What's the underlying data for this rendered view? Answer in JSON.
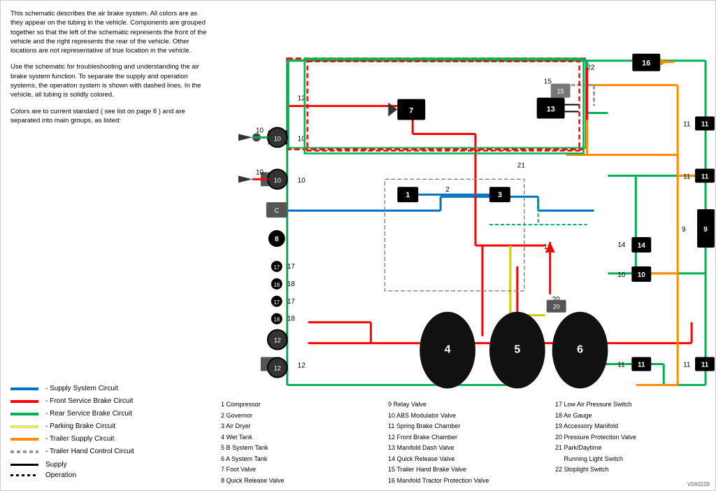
{
  "description1": "This schematic describes the air brake system. All colors are as they appear on the tubing in the vehicle. Components are grouped together so that the left of the schematic represents the front of the vehicle and the right represents the rear of the vehicle. Other locations are not representative of true location in the vehicle.",
  "description2": "Use the schematic for troubleshooting and understanding the air brake system function. To separate the supply and operation systems, the operation system is shown with dashed lines. In the vehicle, all tubing is solidly colored.",
  "description3": "Colors are to current standard ( see list on page 8 ) and are separated into main groups, as listed:",
  "legend": {
    "items": [
      {
        "color": "blue",
        "label": "Supply System Circuit"
      },
      {
        "color": "red",
        "label": "Front Service Brake Circuit"
      },
      {
        "color": "green",
        "label": "Rear Service Brake Circuit"
      },
      {
        "color": "yellow",
        "label": "Parking Brake Circuit"
      },
      {
        "color": "orange",
        "label": "Trailer Supply Circuit"
      },
      {
        "color": "gray-dash",
        "label": "Trailer Hand Control Circuit"
      }
    ],
    "supply_label": "Supply",
    "operation_label": "Operation"
  },
  "parts": {
    "column1": [
      "1   Compressor",
      "2   Governor",
      "3   Air Dryer",
      "4   Wet Tank",
      "5   B System Tank",
      "6   A System Tank",
      "7   Foot Valve",
      "8   Quick Release Valve"
    ],
    "column2": [
      "9   Relay Valve",
      "10  ABS Modulator Valve",
      "11  Spring Brake Chamber",
      "12  Front Brake Chamber",
      "13  Manifold Dash Valve",
      "14  Quick Release Valve",
      "15  Trailer Hand Brake Valve",
      "16  Manifold Tractor Protection Valve"
    ],
    "column3": [
      "17  Low Air Pressure Switch",
      "18  Air Gauge",
      "19  Accessory Manifold",
      "20  Pressure Protection Valve",
      "21  Park/Daytime",
      "      Running Light Switch",
      "22  Stoplight Switch"
    ]
  },
  "version": "V560228"
}
